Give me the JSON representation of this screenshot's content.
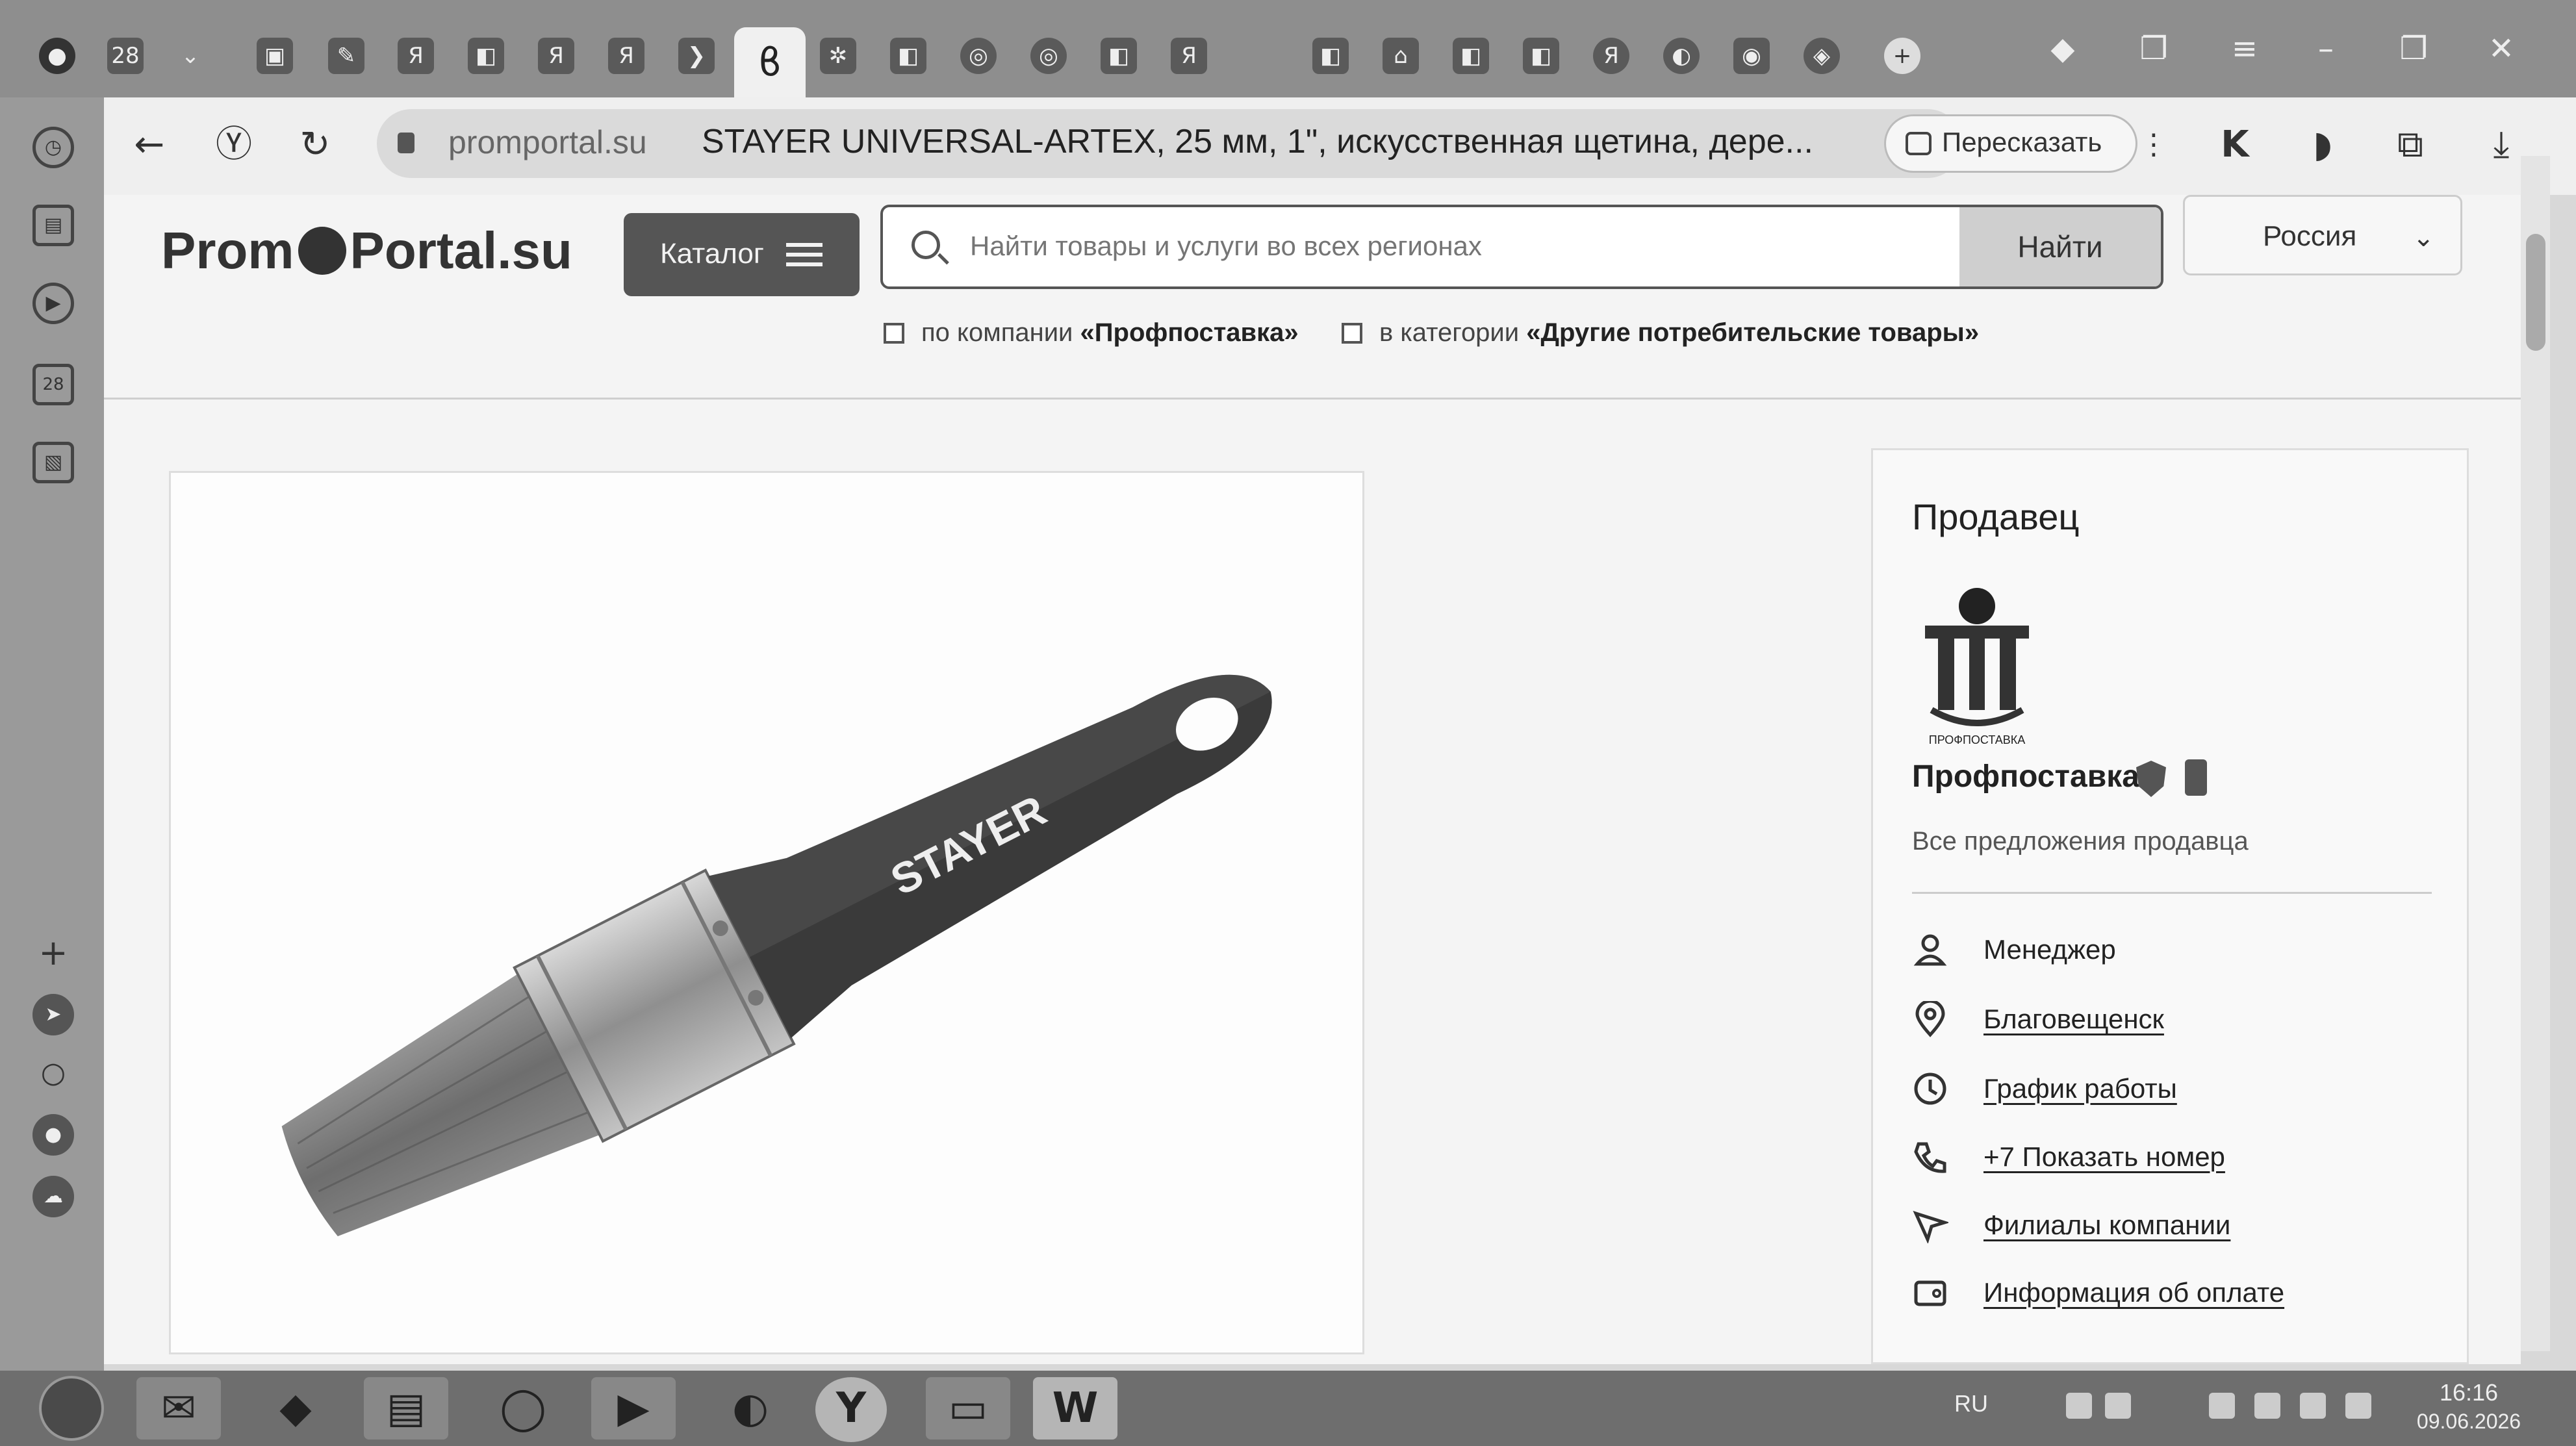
{
  "browser": {
    "tab_icons": [
      "Я",
      "Я",
      "Я",
      "Я",
      "Я",
      "Я"
    ],
    "active_tab_icon": "ϐ",
    "url_domain": "promportal.su",
    "page_title": "STAYER UNIVERSAL-ARTEX, 25 мм, 1\", искусственная щетина, дере...",
    "retell_label": "Пересказать",
    "calendar_day": "28"
  },
  "site": {
    "logo_left": "Prom",
    "logo_right": "Portal.su",
    "catalog_label": "Каталог",
    "search_placeholder": "Найти товары и услуги во всех регионах",
    "search_button": "Найти",
    "region": "Россия",
    "filter_company_prefix": "по компании ",
    "filter_company_name": "«Профпоставка»",
    "filter_category_prefix": "в категории ",
    "filter_category_name": "«Другие потребительские товары»"
  },
  "product": {
    "brand_on_handle": "STAYER"
  },
  "seller": {
    "heading": "Продавец",
    "logo_caption": "ПРОФПОСТАВКА",
    "name": "Профпоставка",
    "all_offers": "Все предложения продавца",
    "rows": [
      {
        "icon": "person-icon",
        "label": "Менеджер",
        "link": false
      },
      {
        "icon": "location-pin-icon",
        "label": "Благовещенск",
        "link": true
      },
      {
        "icon": "clock-icon",
        "label": "График работы",
        "link": true
      },
      {
        "icon": "phone-icon",
        "label": "+7 Показать номер",
        "link": true
      },
      {
        "icon": "navigation-arrow-icon",
        "label": "Филиалы компании",
        "link": true
      },
      {
        "icon": "wallet-icon",
        "label": "Информация об оплате",
        "link": true
      }
    ]
  },
  "taskbar": {
    "word_label": "W",
    "yandex_label": "Y",
    "lang": "RU",
    "time": "16:16",
    "date": "09.06.2026"
  }
}
